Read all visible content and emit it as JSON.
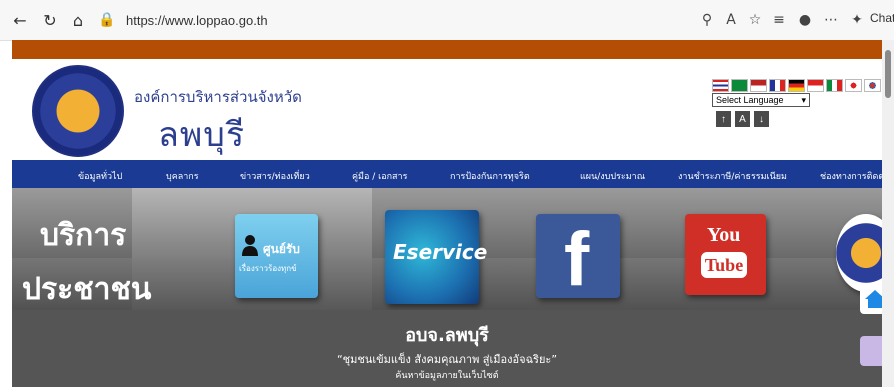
{
  "browser": {
    "url": "https://www.loppao.go.th",
    "chat_label": "Chat"
  },
  "header": {
    "org_small": "องค์การบริหารส่วนจังหวัด",
    "org_big": "ลพบุรี",
    "language_select": "Select Language",
    "size_buttons": [
      "↑",
      "A",
      "↓"
    ]
  },
  "menu": {
    "items": [
      "ข้อมูลทั่วไป",
      "บุคลากร",
      "ข่าวสาร/ท่องเที่ยว",
      "คู่มือ / เอกสาร",
      "การป้องกันการทุจริต",
      "แผน/งบประมาณ",
      "งานชำระภาษี/ค่าธรรมเนียม",
      "ช่องทางการติดต่อ"
    ]
  },
  "banner": {
    "title_line1": "บริการ",
    "title_line2": "ประชาชน",
    "complaint_title": "ศูนย์รับ",
    "complaint_sub": "เรื่องราวร้องทุกข์",
    "eservice_label": "Eservice",
    "fb_label": "f",
    "yt_you": "You",
    "yt_tube": "Tube"
  },
  "footer": {
    "site_name": "อบจ.ลพบุรี",
    "slogan": "“ชุมชนเข้มแข็ง สังคมคุณภาพ สู่เมืองอัจฉริยะ”",
    "search_label": "ค้นหาข้อมูลภายในเว็บไซต์"
  },
  "colors": {
    "top_strip": "#b34e04",
    "menu_bg": "#1b3a93",
    "org_text": "#2c3f8f"
  }
}
